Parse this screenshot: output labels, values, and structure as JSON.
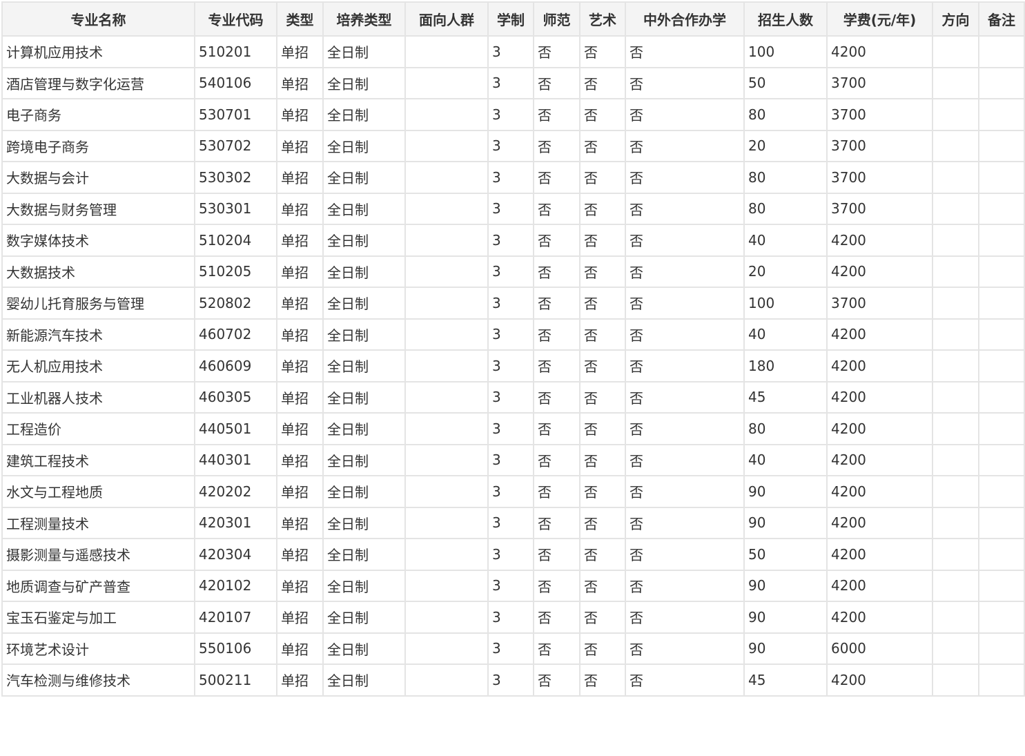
{
  "table": {
    "columns": [
      "专业名称",
      "专业代码",
      "类型",
      "培养类型",
      "面向人群",
      "学制",
      "师范",
      "艺术",
      "中外合作办学",
      "招生人数",
      "学费(元/年)",
      "方向",
      "备注"
    ],
    "rows": [
      [
        "计算机应用技术",
        "510201",
        "单招",
        "全日制",
        "",
        "3",
        "否",
        "否",
        "否",
        "100",
        "4200",
        "",
        ""
      ],
      [
        "酒店管理与数字化运营",
        "540106",
        "单招",
        "全日制",
        "",
        "3",
        "否",
        "否",
        "否",
        "50",
        "3700",
        "",
        ""
      ],
      [
        "电子商务",
        "530701",
        "单招",
        "全日制",
        "",
        "3",
        "否",
        "否",
        "否",
        "80",
        "3700",
        "",
        ""
      ],
      [
        "跨境电子商务",
        "530702",
        "单招",
        "全日制",
        "",
        "3",
        "否",
        "否",
        "否",
        "20",
        "3700",
        "",
        ""
      ],
      [
        "大数据与会计",
        "530302",
        "单招",
        "全日制",
        "",
        "3",
        "否",
        "否",
        "否",
        "80",
        "3700",
        "",
        ""
      ],
      [
        "大数据与财务管理",
        "530301",
        "单招",
        "全日制",
        "",
        "3",
        "否",
        "否",
        "否",
        "80",
        "3700",
        "",
        ""
      ],
      [
        "数字媒体技术",
        "510204",
        "单招",
        "全日制",
        "",
        "3",
        "否",
        "否",
        "否",
        "40",
        "4200",
        "",
        ""
      ],
      [
        "大数据技术",
        "510205",
        "单招",
        "全日制",
        "",
        "3",
        "否",
        "否",
        "否",
        "20",
        "4200",
        "",
        ""
      ],
      [
        "婴幼儿托育服务与管理",
        "520802",
        "单招",
        "全日制",
        "",
        "3",
        "否",
        "否",
        "否",
        "100",
        "3700",
        "",
        ""
      ],
      [
        "新能源汽车技术",
        "460702",
        "单招",
        "全日制",
        "",
        "3",
        "否",
        "否",
        "否",
        "40",
        "4200",
        "",
        ""
      ],
      [
        "无人机应用技术",
        "460609",
        "单招",
        "全日制",
        "",
        "3",
        "否",
        "否",
        "否",
        "180",
        "4200",
        "",
        ""
      ],
      [
        "工业机器人技术",
        "460305",
        "单招",
        "全日制",
        "",
        "3",
        "否",
        "否",
        "否",
        "45",
        "4200",
        "",
        ""
      ],
      [
        "工程造价",
        "440501",
        "单招",
        "全日制",
        "",
        "3",
        "否",
        "否",
        "否",
        "80",
        "4200",
        "",
        ""
      ],
      [
        "建筑工程技术",
        "440301",
        "单招",
        "全日制",
        "",
        "3",
        "否",
        "否",
        "否",
        "40",
        "4200",
        "",
        ""
      ],
      [
        "水文与工程地质",
        "420202",
        "单招",
        "全日制",
        "",
        "3",
        "否",
        "否",
        "否",
        "90",
        "4200",
        "",
        ""
      ],
      [
        "工程测量技术",
        "420301",
        "单招",
        "全日制",
        "",
        "3",
        "否",
        "否",
        "否",
        "90",
        "4200",
        "",
        ""
      ],
      [
        "摄影测量与遥感技术",
        "420304",
        "单招",
        "全日制",
        "",
        "3",
        "否",
        "否",
        "否",
        "50",
        "4200",
        "",
        ""
      ],
      [
        "地质调查与矿产普查",
        "420102",
        "单招",
        "全日制",
        "",
        "3",
        "否",
        "否",
        "否",
        "90",
        "4200",
        "",
        ""
      ],
      [
        "宝玉石鉴定与加工",
        "420107",
        "单招",
        "全日制",
        "",
        "3",
        "否",
        "否",
        "否",
        "90",
        "4200",
        "",
        ""
      ],
      [
        "环境艺术设计",
        "550106",
        "单招",
        "全日制",
        "",
        "3",
        "否",
        "否",
        "否",
        "90",
        "6000",
        "",
        ""
      ],
      [
        "汽车检测与维修技术",
        "500211",
        "单招",
        "全日制",
        "",
        "3",
        "否",
        "否",
        "否",
        "45",
        "4200",
        "",
        ""
      ]
    ]
  }
}
